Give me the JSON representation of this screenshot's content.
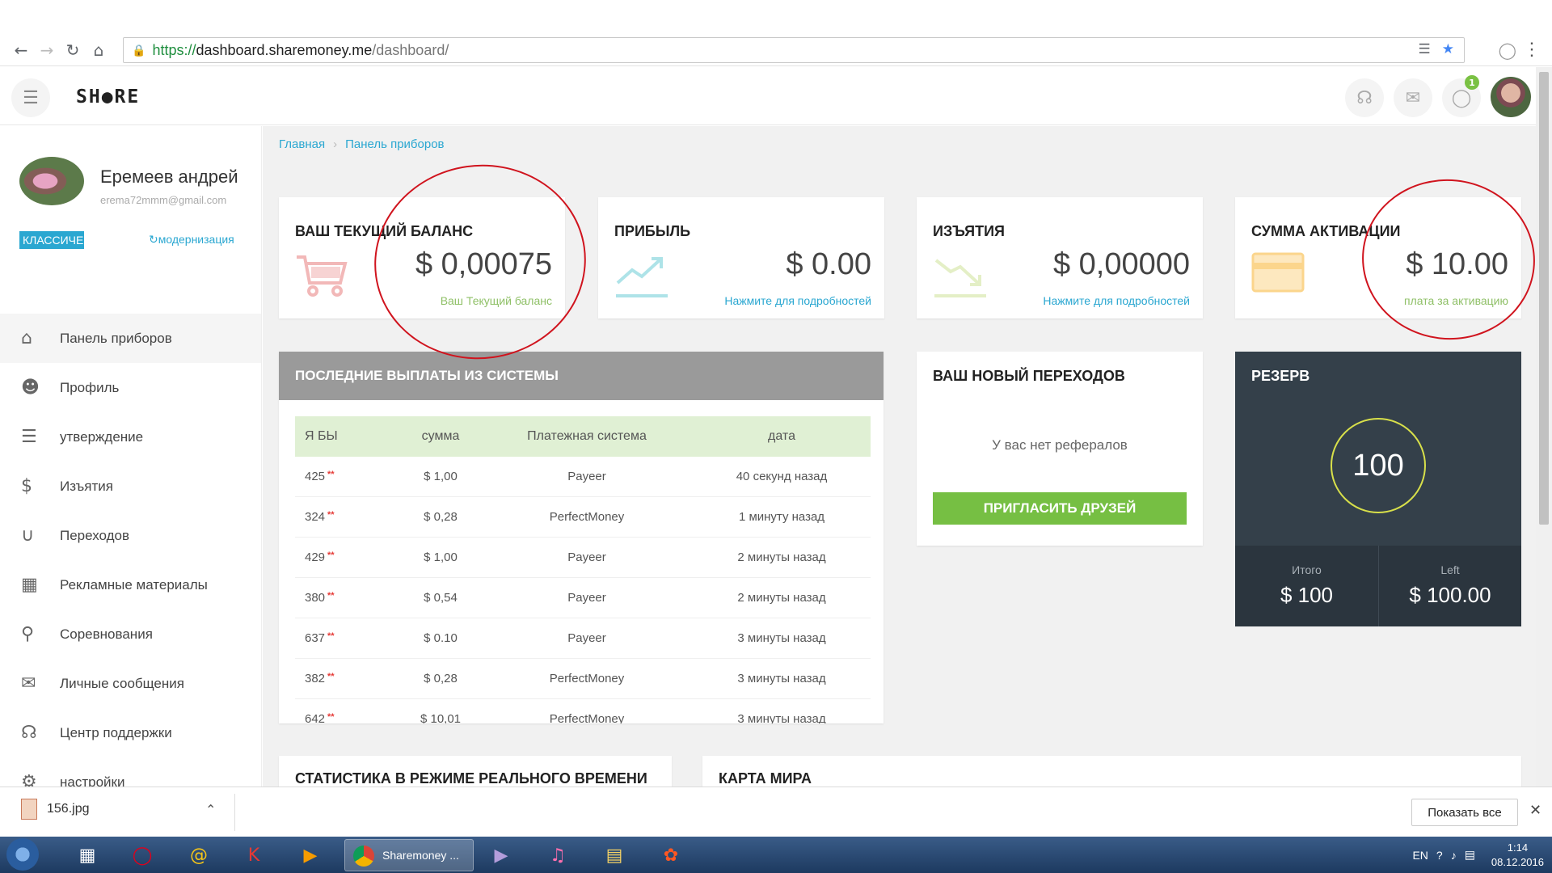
{
  "browser": {
    "url_secure": "https://",
    "url_host": "dashboard.sharemoney.me",
    "url_path": "/dashboard/"
  },
  "header": {
    "logo": "SH●RE",
    "globe_badge": "1"
  },
  "user": {
    "name": "Еремеев андрей",
    "email": "erema72mmm@gmail.com",
    "plan": "КЛАССИЧЕ",
    "upgrade": "модернизация"
  },
  "nav": [
    {
      "label": "Панель приборов",
      "icon": "home-icon"
    },
    {
      "label": "Профиль",
      "icon": "user-icon"
    },
    {
      "label": "утверждение",
      "icon": "list-icon"
    },
    {
      "label": "Изъятия",
      "icon": "dollar-icon"
    },
    {
      "label": "Переходов",
      "icon": "magnet-icon"
    },
    {
      "label": "Рекламные материалы",
      "icon": "film-icon"
    },
    {
      "label": "Соревнования",
      "icon": "trophy-icon"
    },
    {
      "label": "Личные сообщения",
      "icon": "mail-icon"
    },
    {
      "label": "Центр поддержки",
      "icon": "headset-icon"
    },
    {
      "label": "настройки",
      "icon": "gear-icon"
    }
  ],
  "breadcrumb": {
    "home": "Главная",
    "current": "Панель приборов"
  },
  "stats": [
    {
      "title": "ВАШ ТЕКУЩИЙ БАЛАНС",
      "value": "$ 0,00075",
      "sub": "Ваш Текущий баланс",
      "sub_color": "#8fc067",
      "icon": "cart-icon"
    },
    {
      "title": "ПРИБЫЛЬ",
      "value": "$ 0.00",
      "sub": "Нажмите для подробностей",
      "sub_color": "#2aa7d1",
      "icon": "trend-up-icon"
    },
    {
      "title": "ИЗЪЯТИЯ",
      "value": "$ 0,00000",
      "sub": "Нажмите для подробностей",
      "sub_color": "#2aa7d1",
      "icon": "trend-down-icon"
    },
    {
      "title": "СУММА АКТИВАЦИИ",
      "value": "$ 10.00",
      "sub": "плата за активацию",
      "sub_color": "#8fc067",
      "icon": "card-icon"
    }
  ],
  "payouts": {
    "title": "ПОСЛЕДНИЕ ВЫПЛАТЫ ИЗ СИСТЕМЫ",
    "columns": [
      "Я БЫ",
      "сумма",
      "Платежная система",
      "дата"
    ],
    "rows": [
      {
        "id": "425",
        "amount": "$ 1,00",
        "system": "Payeer",
        "date": "40 секунд назад"
      },
      {
        "id": "324",
        "amount": "$ 0,28",
        "system": "PerfectMoney",
        "date": "1 минуту назад"
      },
      {
        "id": "429",
        "amount": "$ 1,00",
        "system": "Payeer",
        "date": "2 минуты назад"
      },
      {
        "id": "380",
        "amount": "$ 0,54",
        "system": "Payeer",
        "date": "2 минуты назад"
      },
      {
        "id": "637",
        "amount": "$ 0.10",
        "system": "Payeer",
        "date": "3 минуты назад"
      },
      {
        "id": "382",
        "amount": "$ 0,28",
        "system": "PerfectMoney",
        "date": "3 минуты назад"
      },
      {
        "id": "642",
        "amount": "$ 10,01",
        "system": "PerfectMoney",
        "date": "3 минуты назад"
      }
    ],
    "star": "**"
  },
  "referrals": {
    "title": "ВАШ НОВЫЙ ПЕРЕХОДОВ",
    "empty": "У вас нет рефералов",
    "button": "ПРИГЛАСИТЬ ДРУЗЕЙ"
  },
  "reserve": {
    "title": "РЕЗЕРВ",
    "value": "100",
    "total_label": "Итого",
    "total_value": "$ 100",
    "left_label": "Left",
    "left_value": "$ 100.00"
  },
  "bottom": {
    "realtime": "СТАТИСТИКА В РЕЖИМЕ РЕАЛЬНОГО ВРЕМЕНИ",
    "worldmap": "КАРТА МИРА"
  },
  "downloads": {
    "file": "156.jpg",
    "show_all": "Показать все"
  },
  "taskbar": {
    "task_label": "Sharemoney ...",
    "lang": "EN",
    "time": "1:14",
    "date": "08.12.2016"
  },
  "colors": {
    "accent": "#2aa7d1",
    "green": "#76bf43",
    "reserve_bg": "#34404a",
    "annotation": "#d0141e"
  }
}
